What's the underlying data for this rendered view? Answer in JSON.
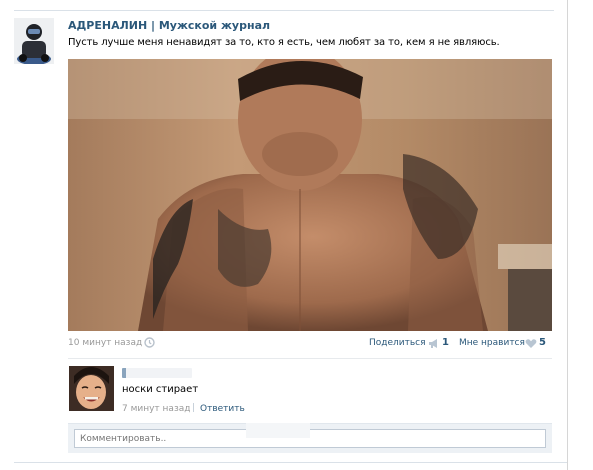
{
  "post": {
    "author": "АДРЕНАЛИН | Мужской журнал",
    "text": "Пусть лучше меня ненавидят за то, кто я есть, чем любят за то, кем я не являюсь.",
    "time": "10 минут назад",
    "share_label": "Поделиться",
    "share_count": "1",
    "like_label": "Мне нравится",
    "like_count": "5"
  },
  "comment": {
    "text": "носки стирает",
    "time": "7 минут назад",
    "separator": "|",
    "reply_label": "Ответить"
  },
  "comment_box": {
    "placeholder": "Комментировать.."
  },
  "icons": {
    "clock": "clock-icon",
    "share": "megaphone-icon",
    "like": "heart-icon"
  },
  "colors": {
    "link": "#2b587a",
    "muted": "#999999",
    "panel": "#edf1f5"
  }
}
